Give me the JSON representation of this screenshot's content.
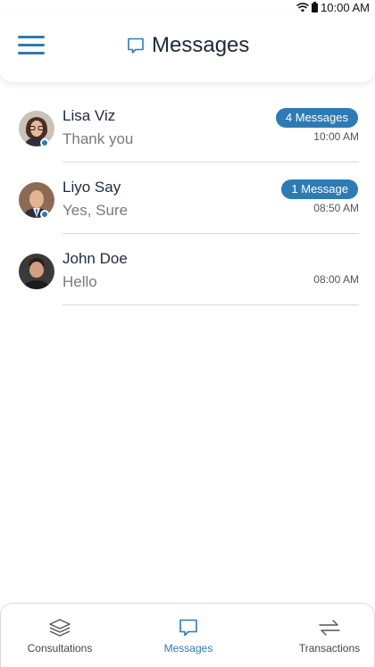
{
  "status_bar": {
    "time": "10:00 AM"
  },
  "header": {
    "title": "Messages"
  },
  "conversations": [
    {
      "name": "Lisa Viz",
      "last_message": "Thank you",
      "badge": "4 Messages",
      "time": "10:00 AM",
      "online": true
    },
    {
      "name": "Liyo Say",
      "last_message": "Yes, Sure",
      "badge": "1 Message",
      "time": "08:50 AM",
      "online": true
    },
    {
      "name": "John Doe",
      "last_message": "Hello",
      "badge": "",
      "time": "08:00 AM",
      "online": false
    }
  ],
  "bottom_nav": [
    {
      "label": "Consultations",
      "icon": "layers-icon",
      "active": false
    },
    {
      "label": "Messages",
      "icon": "chat-icon",
      "active": true
    },
    {
      "label": "Transactions",
      "icon": "transfer-arrows-icon",
      "active": false
    }
  ],
  "colors": {
    "accent": "#2d7bb6",
    "text": "#1e2a3a",
    "muted": "#7a7a7a"
  }
}
